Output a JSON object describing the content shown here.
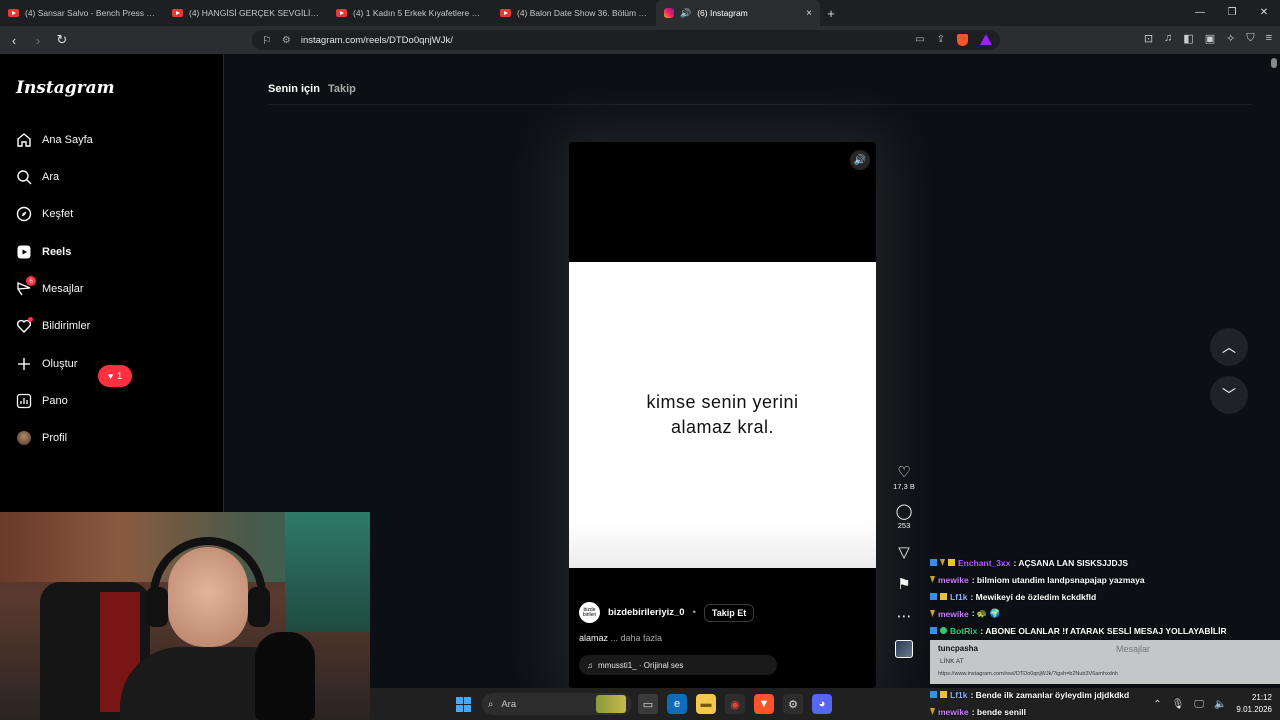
{
  "browser": {
    "tabs": [
      {
        "label": "(4) Sansar Salvo - Bench Press 2025",
        "type": "youtube",
        "active": false
      },
      {
        "label": "(4) HANGİSİ GERÇEK SEVGİLİ?? ft. @",
        "type": "youtube",
        "active": false
      },
      {
        "label": "(4) 1 Kadın 5 Erkek Kıyafetlere Göre E",
        "type": "youtube",
        "active": false
      },
      {
        "label": "(4) Balon Date Show 36. Bölüm - You",
        "type": "youtube",
        "active": false
      },
      {
        "label": "(6) Instagram",
        "type": "instagram",
        "active": true
      }
    ],
    "close_tab_glyph": "×",
    "new_tab_glyph": "+",
    "url": "instagram.com/reels/DTDo0qnjWJk/"
  },
  "instagram": {
    "logo": "Instagram",
    "nav": [
      {
        "label": "Ana Sayfa",
        "icon": "home-icon"
      },
      {
        "label": "Ara",
        "icon": "search-icon"
      },
      {
        "label": "Keşfet",
        "icon": "compass-icon"
      },
      {
        "label": "Reels",
        "icon": "reels-icon",
        "active": true
      },
      {
        "label": "Mesajlar",
        "icon": "messenger-icon",
        "badge": "6"
      },
      {
        "label": "Bildirimler",
        "icon": "heart-icon"
      },
      {
        "label": "Oluştur",
        "icon": "plus-icon"
      },
      {
        "label": "Pano",
        "icon": "dashboard-icon"
      },
      {
        "label": "Profil",
        "icon": "avatar-icon"
      }
    ],
    "notification_count": "1",
    "feed_tabs": {
      "for_you": "Senin için",
      "following": "Takip"
    }
  },
  "reel": {
    "text": "kimse senin  yerini\nalamaz  kral.",
    "username": "bizdebirileriyiz_0",
    "avatar_text": "bizde birileri",
    "dot": "•",
    "follow_label": "Takip Et",
    "caption": "alamaz",
    "caption_more": "... daha fazla",
    "audio": "mmussti1_ · Orijinal ses",
    "likes": "17,3 B",
    "comments": "253"
  },
  "chat": {
    "lines_top": [
      {
        "user": "Enchant_3xx",
        "color": "#b05cff",
        "message": ": AÇSANA LAN SISKSJJDJS"
      },
      {
        "user": "mewike",
        "color": "#c77dff",
        "message": ": bilmiom utandim landpsnapajap yazmaya"
      },
      {
        "user": "Lf1k",
        "color": "#8ab4ff",
        "message": ": Mewikeyi de özledim kckdkfld"
      },
      {
        "user": "mewike",
        "color": "#c77dff",
        "message": ": 🐢 🌍"
      },
      {
        "user": "BotRix",
        "color": "#2ecc71",
        "message": ": ABONE OLANLAR !f ATARAK SESLİ MESAJ YOLLAYABİLİR"
      }
    ],
    "highlight": {
      "user": "tuncpasha",
      "message": "LİNK AT",
      "url": "https://www.instagram.com/reel/DTDo0qnjWJk/?igsh=b2Nub3V6amhxdnh",
      "ghost": "Mesajlar"
    },
    "lines_bottom": [
      {
        "user": "Lf1k",
        "color": "#8ab4ff",
        "message": ": Bende ilk zamanlar öyleydim jdjdkdkd"
      },
      {
        "user": "mewike",
        "color": "#c77dff",
        "message": ": bende senill"
      }
    ]
  },
  "taskbar": {
    "search_label": "Ara",
    "time": "21:12",
    "date": "9.01.2026"
  }
}
